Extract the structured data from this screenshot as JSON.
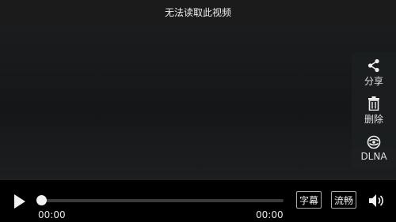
{
  "header": {
    "title": "无法读取此视频"
  },
  "side_panel": {
    "items": [
      {
        "label": "分享",
        "icon": "share-icon"
      },
      {
        "label": "删除",
        "icon": "trash-icon"
      },
      {
        "label": "DLNA",
        "icon": "dlna-icon"
      }
    ]
  },
  "player": {
    "current_time": "00:00",
    "duration": "00:00",
    "progress": 0,
    "subtitle_label": "字幕",
    "quality_label": "流畅"
  }
}
